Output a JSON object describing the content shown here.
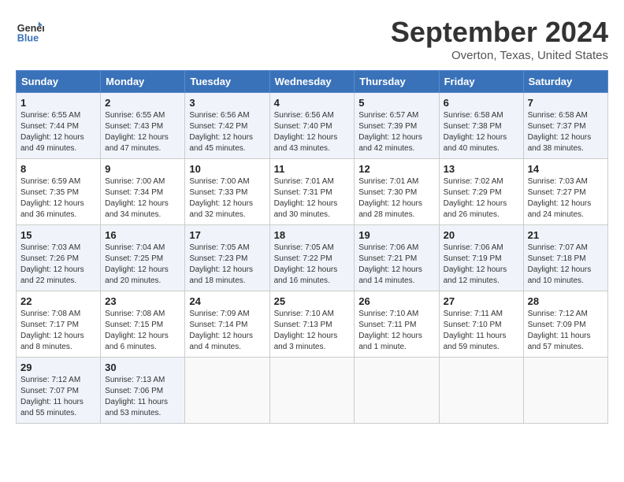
{
  "header": {
    "logo_line1": "General",
    "logo_line2": "Blue",
    "month": "September 2024",
    "location": "Overton, Texas, United States"
  },
  "weekdays": [
    "Sunday",
    "Monday",
    "Tuesday",
    "Wednesday",
    "Thursday",
    "Friday",
    "Saturday"
  ],
  "weeks": [
    [
      {
        "day": "1",
        "sunrise": "Sunrise: 6:55 AM",
        "sunset": "Sunset: 7:44 PM",
        "daylight": "Daylight: 12 hours and 49 minutes."
      },
      {
        "day": "2",
        "sunrise": "Sunrise: 6:55 AM",
        "sunset": "Sunset: 7:43 PM",
        "daylight": "Daylight: 12 hours and 47 minutes."
      },
      {
        "day": "3",
        "sunrise": "Sunrise: 6:56 AM",
        "sunset": "Sunset: 7:42 PM",
        "daylight": "Daylight: 12 hours and 45 minutes."
      },
      {
        "day": "4",
        "sunrise": "Sunrise: 6:56 AM",
        "sunset": "Sunset: 7:40 PM",
        "daylight": "Daylight: 12 hours and 43 minutes."
      },
      {
        "day": "5",
        "sunrise": "Sunrise: 6:57 AM",
        "sunset": "Sunset: 7:39 PM",
        "daylight": "Daylight: 12 hours and 42 minutes."
      },
      {
        "day": "6",
        "sunrise": "Sunrise: 6:58 AM",
        "sunset": "Sunset: 7:38 PM",
        "daylight": "Daylight: 12 hours and 40 minutes."
      },
      {
        "day": "7",
        "sunrise": "Sunrise: 6:58 AM",
        "sunset": "Sunset: 7:37 PM",
        "daylight": "Daylight: 12 hours and 38 minutes."
      }
    ],
    [
      {
        "day": "8",
        "sunrise": "Sunrise: 6:59 AM",
        "sunset": "Sunset: 7:35 PM",
        "daylight": "Daylight: 12 hours and 36 minutes."
      },
      {
        "day": "9",
        "sunrise": "Sunrise: 7:00 AM",
        "sunset": "Sunset: 7:34 PM",
        "daylight": "Daylight: 12 hours and 34 minutes."
      },
      {
        "day": "10",
        "sunrise": "Sunrise: 7:00 AM",
        "sunset": "Sunset: 7:33 PM",
        "daylight": "Daylight: 12 hours and 32 minutes."
      },
      {
        "day": "11",
        "sunrise": "Sunrise: 7:01 AM",
        "sunset": "Sunset: 7:31 PM",
        "daylight": "Daylight: 12 hours and 30 minutes."
      },
      {
        "day": "12",
        "sunrise": "Sunrise: 7:01 AM",
        "sunset": "Sunset: 7:30 PM",
        "daylight": "Daylight: 12 hours and 28 minutes."
      },
      {
        "day": "13",
        "sunrise": "Sunrise: 7:02 AM",
        "sunset": "Sunset: 7:29 PM",
        "daylight": "Daylight: 12 hours and 26 minutes."
      },
      {
        "day": "14",
        "sunrise": "Sunrise: 7:03 AM",
        "sunset": "Sunset: 7:27 PM",
        "daylight": "Daylight: 12 hours and 24 minutes."
      }
    ],
    [
      {
        "day": "15",
        "sunrise": "Sunrise: 7:03 AM",
        "sunset": "Sunset: 7:26 PM",
        "daylight": "Daylight: 12 hours and 22 minutes."
      },
      {
        "day": "16",
        "sunrise": "Sunrise: 7:04 AM",
        "sunset": "Sunset: 7:25 PM",
        "daylight": "Daylight: 12 hours and 20 minutes."
      },
      {
        "day": "17",
        "sunrise": "Sunrise: 7:05 AM",
        "sunset": "Sunset: 7:23 PM",
        "daylight": "Daylight: 12 hours and 18 minutes."
      },
      {
        "day": "18",
        "sunrise": "Sunrise: 7:05 AM",
        "sunset": "Sunset: 7:22 PM",
        "daylight": "Daylight: 12 hours and 16 minutes."
      },
      {
        "day": "19",
        "sunrise": "Sunrise: 7:06 AM",
        "sunset": "Sunset: 7:21 PM",
        "daylight": "Daylight: 12 hours and 14 minutes."
      },
      {
        "day": "20",
        "sunrise": "Sunrise: 7:06 AM",
        "sunset": "Sunset: 7:19 PM",
        "daylight": "Daylight: 12 hours and 12 minutes."
      },
      {
        "day": "21",
        "sunrise": "Sunrise: 7:07 AM",
        "sunset": "Sunset: 7:18 PM",
        "daylight": "Daylight: 12 hours and 10 minutes."
      }
    ],
    [
      {
        "day": "22",
        "sunrise": "Sunrise: 7:08 AM",
        "sunset": "Sunset: 7:17 PM",
        "daylight": "Daylight: 12 hours and 8 minutes."
      },
      {
        "day": "23",
        "sunrise": "Sunrise: 7:08 AM",
        "sunset": "Sunset: 7:15 PM",
        "daylight": "Daylight: 12 hours and 6 minutes."
      },
      {
        "day": "24",
        "sunrise": "Sunrise: 7:09 AM",
        "sunset": "Sunset: 7:14 PM",
        "daylight": "Daylight: 12 hours and 4 minutes."
      },
      {
        "day": "25",
        "sunrise": "Sunrise: 7:10 AM",
        "sunset": "Sunset: 7:13 PM",
        "daylight": "Daylight: 12 hours and 3 minutes."
      },
      {
        "day": "26",
        "sunrise": "Sunrise: 7:10 AM",
        "sunset": "Sunset: 7:11 PM",
        "daylight": "Daylight: 12 hours and 1 minute."
      },
      {
        "day": "27",
        "sunrise": "Sunrise: 7:11 AM",
        "sunset": "Sunset: 7:10 PM",
        "daylight": "Daylight: 11 hours and 59 minutes."
      },
      {
        "day": "28",
        "sunrise": "Sunrise: 7:12 AM",
        "sunset": "Sunset: 7:09 PM",
        "daylight": "Daylight: 11 hours and 57 minutes."
      }
    ],
    [
      {
        "day": "29",
        "sunrise": "Sunrise: 7:12 AM",
        "sunset": "Sunset: 7:07 PM",
        "daylight": "Daylight: 11 hours and 55 minutes."
      },
      {
        "day": "30",
        "sunrise": "Sunrise: 7:13 AM",
        "sunset": "Sunset: 7:06 PM",
        "daylight": "Daylight: 11 hours and 53 minutes."
      },
      null,
      null,
      null,
      null,
      null
    ]
  ]
}
